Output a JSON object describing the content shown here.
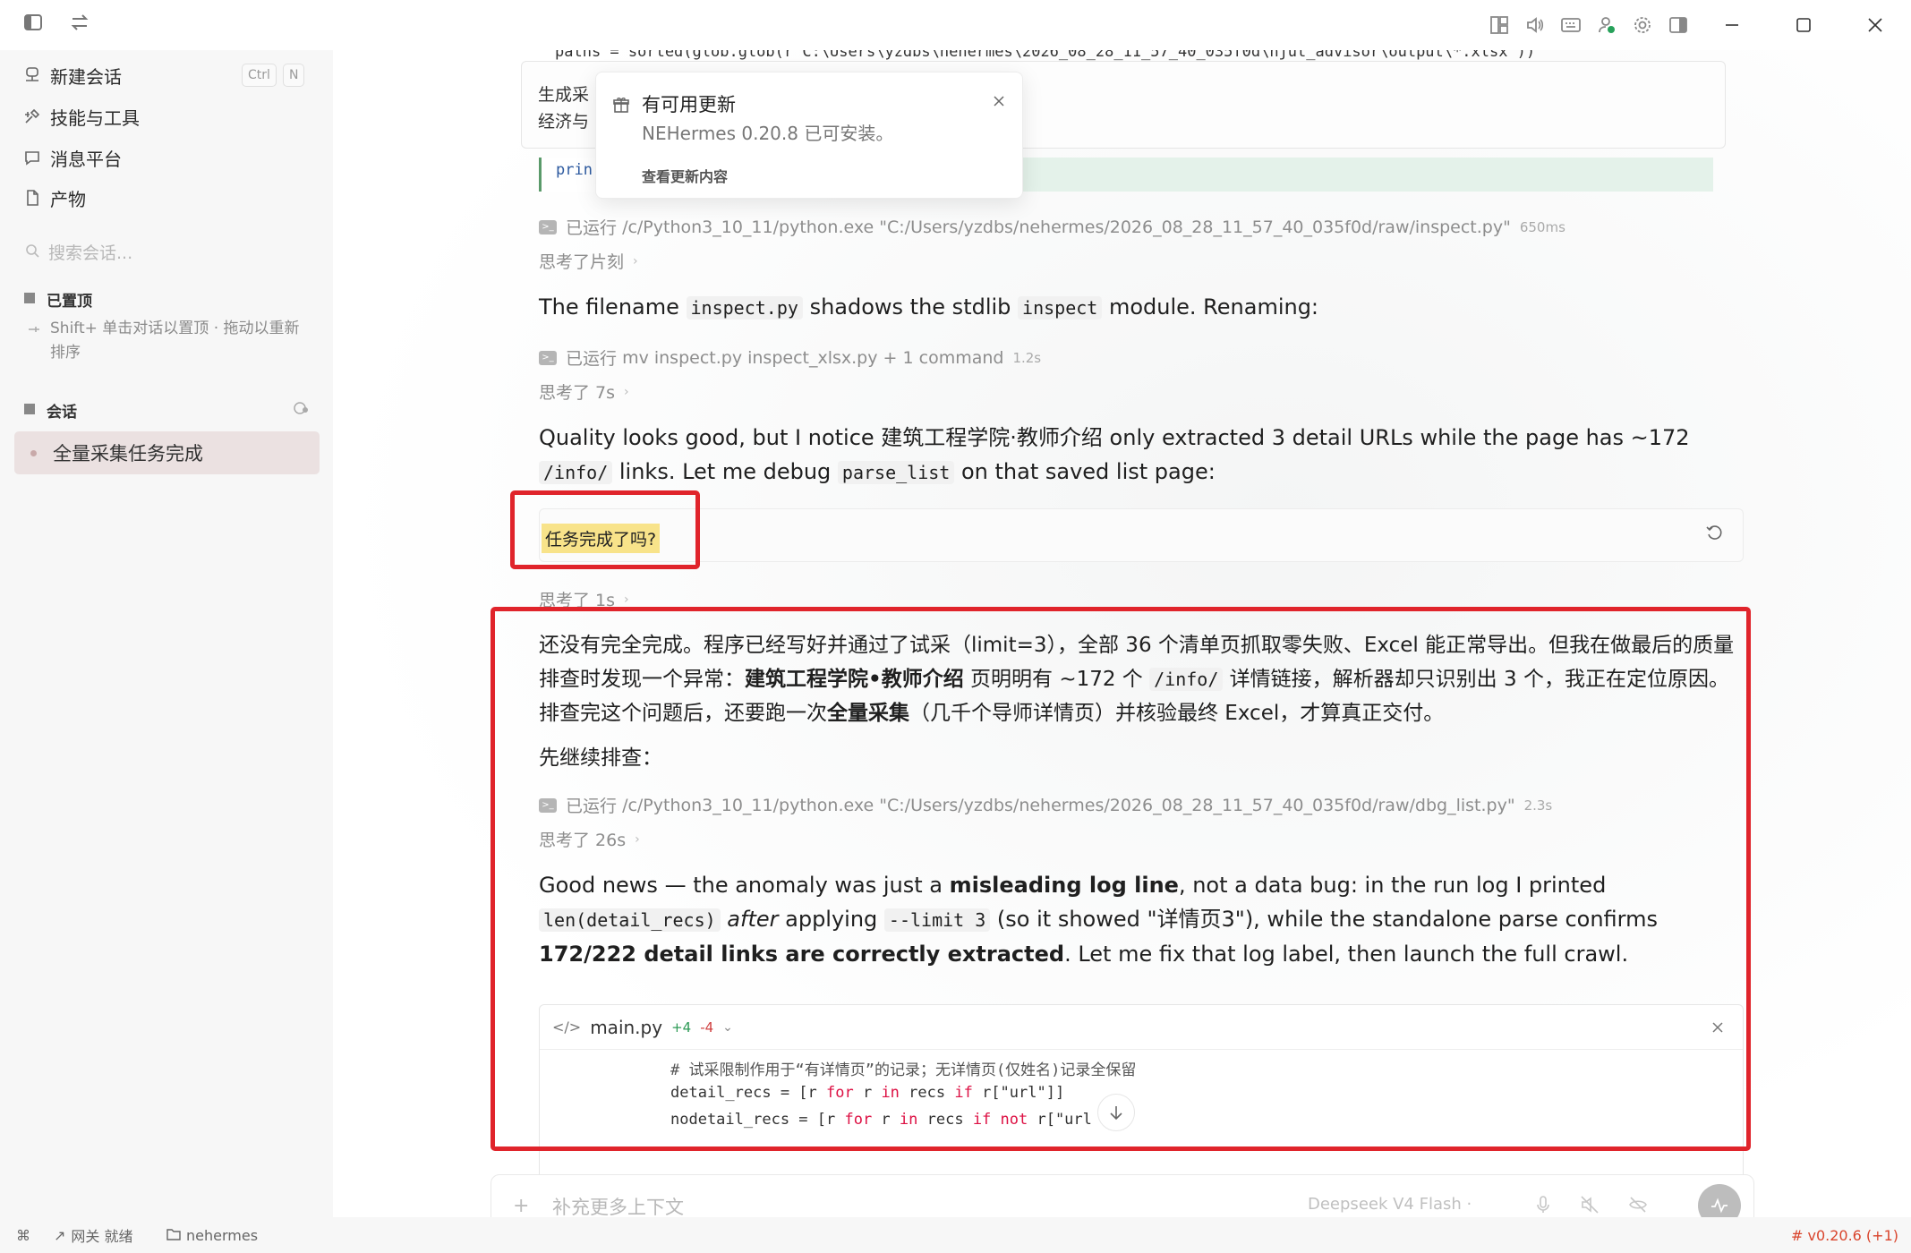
{
  "titlebar": {
    "icons": [
      "sidebar-toggle-icon",
      "swap-icon",
      "layout-icon",
      "volume-icon",
      "keyboard-icon",
      "user-status-icon",
      "gear-icon",
      "panel-icon"
    ]
  },
  "sidebar": {
    "new_chat": "新建会话",
    "new_chat_kbd_1": "Ctrl",
    "new_chat_kbd_2": "N",
    "skills": "技能与工具",
    "messages": "消息平台",
    "artifacts": "产物",
    "search_placeholder": "搜索会话...",
    "pinned_title": "已置顶",
    "pinned_hint": "Shift+ 单击对话以置顶 · 拖动以重新排序",
    "sessions_title": "会话",
    "session_active": "全量采集任务完成"
  },
  "update_popup": {
    "title": "有可用更新",
    "subtitle": "NEHermes 0.20.8 已可安装。",
    "link": "查看更新内容"
  },
  "chat": {
    "code_top": "paths = sorted(glob.glob(r'C:\\Users\\yzdbs\\nehermes\\2026_08_28_11_57_40_035f0d\\hjut_advisor\\output\\*.xlsx'))",
    "card_behind_line1": "生成采",
    "card_behind_line2": "经济与",
    "code_partial": "prin",
    "run1": {
      "label": "已运行",
      "cmd": "/c/Python3_10_11/python.exe \"C:/Users/yzdbs/nehermes/2026_08_28_11_57_40_035f0d/raw/inspect.py\"",
      "dur": "650ms"
    },
    "think1": "思考了片刻",
    "p1_a": "The filename ",
    "p1_code1": "inspect.py",
    "p1_b": " shadows the stdlib ",
    "p1_code2": "inspect",
    "p1_c": " module. Renaming:",
    "run2": {
      "label": "已运行",
      "cmd": "mv inspect.py inspect_xlsx.py",
      "extra": "+ 1 command",
      "dur": "1.2s"
    },
    "think2": "思考了 7s",
    "p2_a": "Quality looks good, but I notice 建筑工程学院·教师介绍 only extracted 3 detail URLs while the page has ~172 ",
    "p2_code1": "/info/",
    "p2_b": " links. Let me debug ",
    "p2_code2": "parse_list",
    "p2_c": " on that saved list page:",
    "user_message": "任务完成了吗?",
    "think3": "思考了 1s",
    "zh1_a": "还没有完全完成。程序已经写好并通过了试采（limit=3），全部 36 个清单页抓取零失败、Excel 能正常导出。但我在做最后的质量排查时发现一个异常：",
    "zh1_bold": "建筑工程学院•教师介绍",
    "zh1_b": " 页明明有 ~172 个 ",
    "zh1_code": "/info/",
    "zh1_c": " 详情链接，解析器却只识别出 3 个，我正在定位原因。排查完这个问题后，还要跑一次",
    "zh1_bold2": "全量采集",
    "zh1_d": "（几千个导师详情页）并核验最终 Excel，才算真正交付。",
    "zh2": "先继续排查：",
    "run3": {
      "label": "已运行",
      "cmd": "/c/Python3_10_11/python.exe \"C:/Users/yzdbs/nehermes/2026_08_28_11_57_40_035f0d/raw/dbg_list.py\"",
      "dur": "2.3s"
    },
    "think4": "思考了 26s",
    "p3_a": "Good news — the anomaly was just a ",
    "p3_bold1": "misleading log line",
    "p3_b": ", not a data bug: in the run log I printed ",
    "p3_code1": "len(detail_recs)",
    "p3_em": "after",
    "p3_c": " applying ",
    "p3_code2": "--limit 3",
    "p3_d": " (so it showed \"详情页3\"), while the standalone parse confirms ",
    "p3_bold2": "172/222 detail links are correctly extracted",
    "p3_e": ". Let me fix that log label, then launch the full crawl.",
    "diff": {
      "filename": "main.py",
      "plus": "+4",
      "minus": "-4",
      "line1": "# 试采限制作用于“有详情页”的记录；无详情页(仅姓名)记录全保留",
      "line2_a": "detail_recs = [r ",
      "line2_for": "for",
      "line2_b": " r ",
      "line2_in": "in",
      "line2_c": " recs ",
      "line2_if": "if",
      "line2_d": " r[\"url\"]]",
      "line3_a": "nodetail_recs = [r ",
      "line3_for": "for",
      "line3_b": " r ",
      "line3_in": "in",
      "line3_c": " recs ",
      "line3_if": "if not",
      "line3_d": " r[\"url"
    }
  },
  "composer": {
    "placeholder": "补充更多上下文",
    "model": "Deepseek V4 Flash ·"
  },
  "statusbar": {
    "gateway": "网关 就绪",
    "folder": "nehermes",
    "version": "# v0.20.6 (+1)"
  },
  "colors": {
    "highlight_box": "#e0242b",
    "accent_version": "#d9442c",
    "user_highlight": "#f8e38a"
  }
}
